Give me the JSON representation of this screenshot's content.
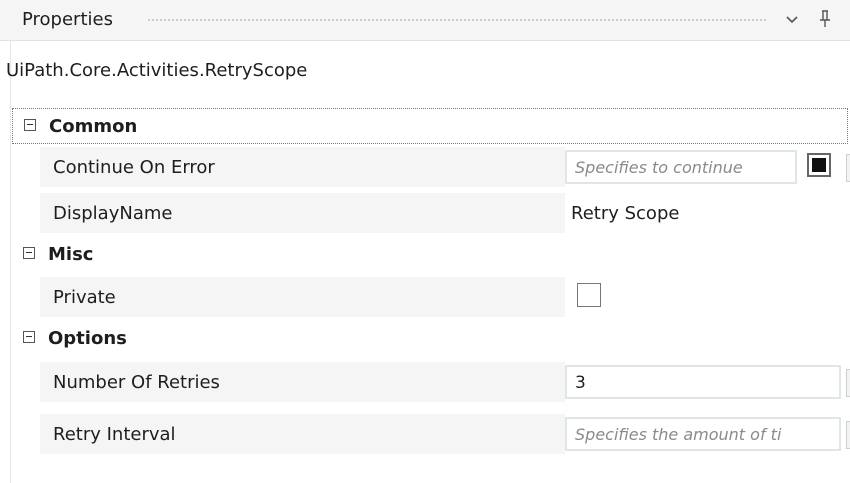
{
  "panel": {
    "title": "Properties",
    "type_name": "UiPath.Core.Activities.RetryScope",
    "ellipsis_label": "..."
  },
  "categories": [
    {
      "label": "Common",
      "properties": [
        {
          "name": "Continue On Error",
          "placeholder": "Specifies to continue",
          "checked": true
        },
        {
          "name": "DisplayName",
          "value": "Retry Scope"
        }
      ]
    },
    {
      "label": "Misc",
      "properties": [
        {
          "name": "Private",
          "checked": false
        }
      ]
    },
    {
      "label": "Options",
      "properties": [
        {
          "name": "Number Of Retries",
          "value": "3"
        },
        {
          "name": "Retry Interval",
          "placeholder": "Specifies the amount of ti"
        }
      ]
    }
  ],
  "icons": {
    "dropdown": "chevron-down-icon",
    "pin": "pin-icon",
    "collapse": "collapse-icon"
  }
}
